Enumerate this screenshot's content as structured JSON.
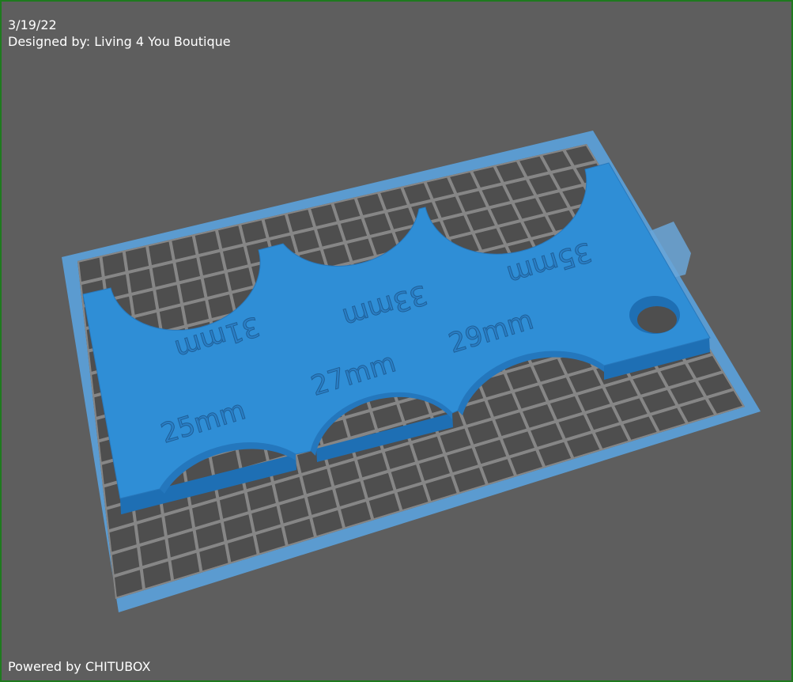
{
  "viewport": {
    "date": "3/19/22",
    "designer": "Designed by: Living 4 You Boutique",
    "powered_by": "Powered by CHITUBOX"
  },
  "model": {
    "engravings": {
      "s25": "25mm",
      "s27": "27mm",
      "s29": "29mm",
      "s31": "31mm",
      "s33": "33mm",
      "s35": "35mm"
    }
  },
  "colors": {
    "background": "#5e5e5e",
    "border": "#1e7a1e",
    "plate_outline": "#5b9bd0",
    "grid_cell": "#4e4e4e",
    "grid_line": "#868686",
    "model_top": "#2f8ed6",
    "model_side": "#1e6fb4"
  }
}
